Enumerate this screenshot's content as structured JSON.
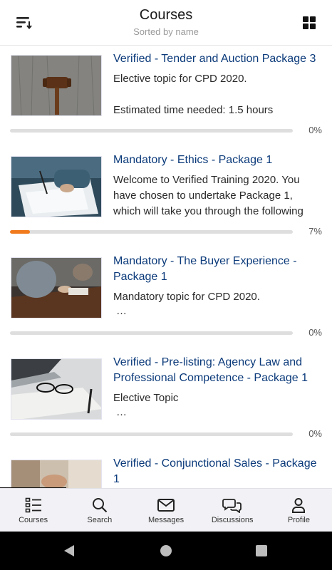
{
  "header": {
    "title": "Courses",
    "subtitle": "Sorted by name",
    "left_icon": "sort-icon",
    "right_icon": "grid-view-icon"
  },
  "courses": [
    {
      "title": "Verified - Tender and Auction Package 3",
      "desc": "Elective topic for CPD 2020.",
      "desc2": "Estimated time needed: 1.5 hours",
      "progress": 0,
      "progress_label": "0%"
    },
    {
      "title": "Mandatory - Ethics - Package 1",
      "desc_lines": [
        "Welcome to Verified Training 2020. You",
        "have chosen to undertake Package 1,",
        "which will take you through the following"
      ],
      "progress": 7,
      "progress_label": "7%"
    },
    {
      "title": "Mandatory - The Buyer Experience - Package 1",
      "desc": "Mandatory topic for CPD 2020.",
      "ellipsis": "…",
      "progress": 0,
      "progress_label": "0%"
    },
    {
      "title": "Verified - Pre-listing: Agency Law and Professional Competence - Package 1",
      "desc": "Elective Topic",
      "ellipsis": "…",
      "progress": 0,
      "progress_label": "0%"
    },
    {
      "title": "Verified - Conjunctional Sales - Package 1"
    }
  ],
  "tabs": [
    {
      "label": "Courses",
      "icon": "courses-icon"
    },
    {
      "label": "Search",
      "icon": "search-icon"
    },
    {
      "label": "Messages",
      "icon": "messages-icon"
    },
    {
      "label": "Discussions",
      "icon": "discussions-icon"
    },
    {
      "label": "Profile",
      "icon": "profile-icon"
    }
  ],
  "colors": {
    "accent": "#f07a1c",
    "title_blue": "#0b3a7a"
  }
}
